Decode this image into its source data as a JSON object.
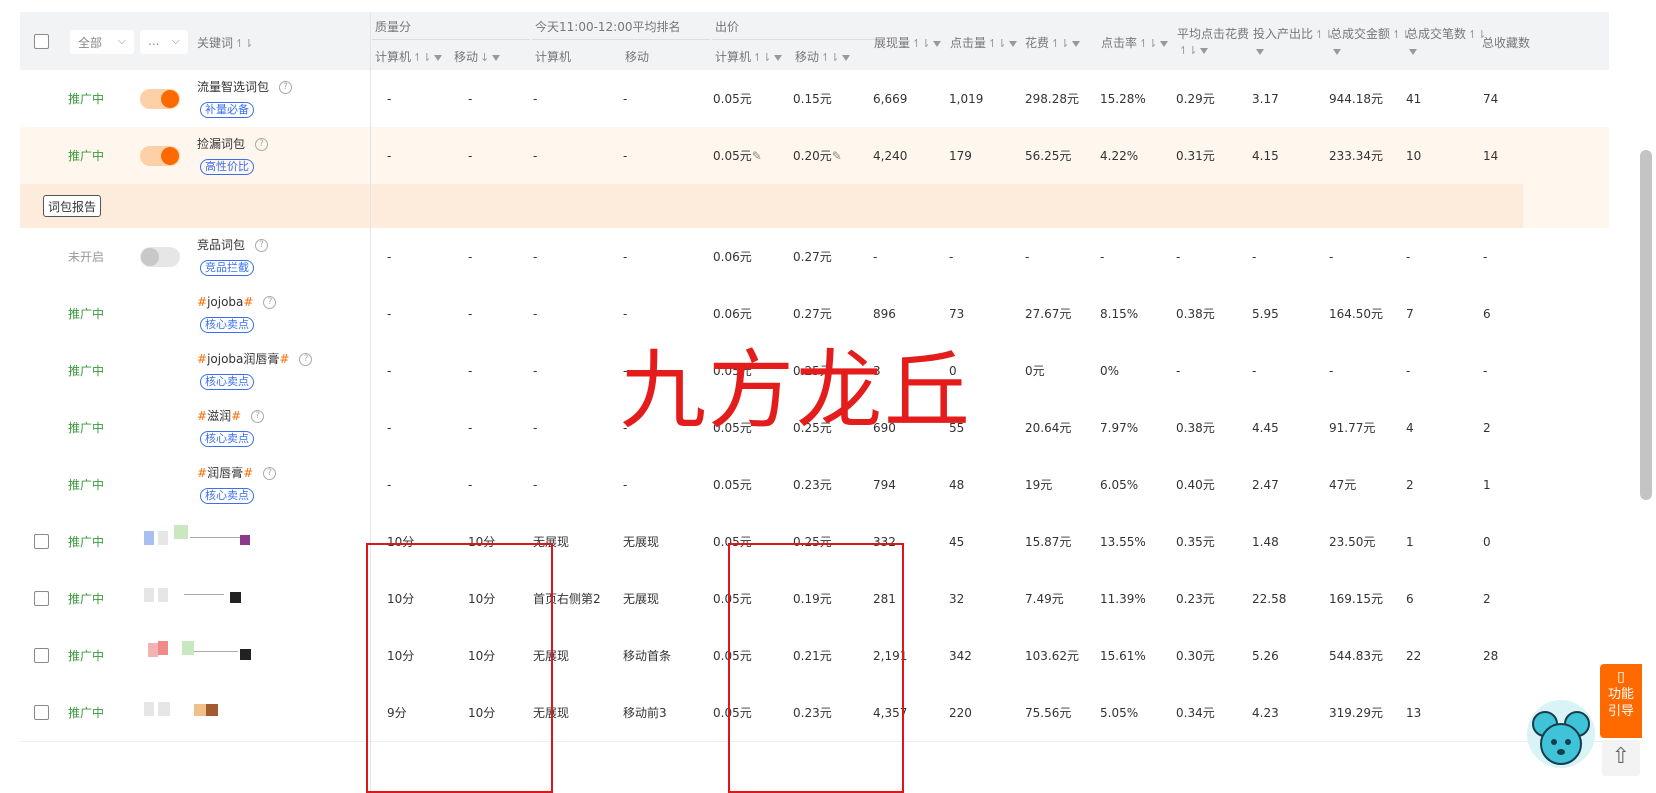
{
  "header": {
    "select_all": "全部",
    "select_more": "...",
    "col_keyword": "关键词",
    "group_quality": "质量分",
    "group_rank": "今天11:00-12:00平均排名",
    "group_bid": "出价",
    "pc": "计算机",
    "mobile": "移动",
    "impressions": "展现量",
    "clicks": "点击量",
    "cost": "花费",
    "ctr": "点击率",
    "avg_cpc": "平均点击花费",
    "roi": "投入产出比",
    "total_gmv": "总成交金额",
    "total_orders": "总成交笔数",
    "total_fav": "总收藏数"
  },
  "rows": [
    {
      "status": "推广中",
      "toggle": "on",
      "keyword": "流量智选词包",
      "hash": false,
      "tag": "补量必备",
      "qpc": "-",
      "qm": "-",
      "rpc": "-",
      "rm": "-",
      "bpc": "0.05元",
      "bm": "0.15元",
      "imp": "6,669",
      "clk": "1,019",
      "cost": "298.28元",
      "ctr": "15.28%",
      "cpc": "0.29元",
      "roi": "3.17",
      "gmv": "944.18元",
      "ord": "41",
      "fav": "74"
    },
    {
      "status": "推广中",
      "toggle": "on",
      "keyword": "捡漏词包",
      "hash": false,
      "tag": "高性价比",
      "qpc": "-",
      "qm": "-",
      "rpc": "-",
      "rm": "-",
      "bpc": "0.05元",
      "bm": "0.20元",
      "imp": "4,240",
      "clk": "179",
      "cost": "56.25元",
      "ctr": "4.22%",
      "cpc": "0.31元",
      "roi": "4.15",
      "gmv": "233.34元",
      "ord": "10",
      "fav": "14"
    },
    {
      "status": "未开启",
      "toggle": "off",
      "keyword": "竞品词包",
      "hash": false,
      "tag": "竞品拦截",
      "qpc": "-",
      "qm": "-",
      "rpc": "-",
      "rm": "-",
      "bpc": "0.06元",
      "bm": "0.27元",
      "imp": "-",
      "clk": "-",
      "cost": "-",
      "ctr": "-",
      "cpc": "-",
      "roi": "-",
      "gmv": "-",
      "ord": "-",
      "fav": "-"
    },
    {
      "status": "推广中",
      "toggle": "none",
      "keyword": "jojoba",
      "hash": true,
      "tag": "核心卖点",
      "qpc": "-",
      "qm": "-",
      "rpc": "-",
      "rm": "-",
      "bpc": "0.06元",
      "bm": "0.27元",
      "imp": "896",
      "clk": "73",
      "cost": "27.67元",
      "ctr": "8.15%",
      "cpc": "0.38元",
      "roi": "5.95",
      "gmv": "164.50元",
      "ord": "7",
      "fav": "6"
    },
    {
      "status": "推广中",
      "toggle": "none",
      "keyword": "jojoba润唇膏",
      "hash": true,
      "tag": "核心卖点",
      "qpc": "-",
      "qm": "-",
      "rpc": "-",
      "rm": "-",
      "bpc": "0.05元",
      "bm": "0.25元",
      "imp": "3",
      "clk": "0",
      "cost": "0元",
      "ctr": "0%",
      "cpc": "-",
      "roi": "-",
      "gmv": "-",
      "ord": "-",
      "fav": "-"
    },
    {
      "status": "推广中",
      "toggle": "none",
      "keyword": "滋润",
      "hash": true,
      "tag": "核心卖点",
      "qpc": "-",
      "qm": "-",
      "rpc": "-",
      "rm": "-",
      "bpc": "0.05元",
      "bm": "0.25元",
      "imp": "690",
      "clk": "55",
      "cost": "20.64元",
      "ctr": "7.97%",
      "cpc": "0.38元",
      "roi": "4.45",
      "gmv": "91.77元",
      "ord": "4",
      "fav": "2"
    },
    {
      "status": "推广中",
      "toggle": "none",
      "keyword": "润唇膏",
      "hash": true,
      "tag": "核心卖点",
      "qpc": "-",
      "qm": "-",
      "rpc": "-",
      "rm": "-",
      "bpc": "0.05元",
      "bm": "0.23元",
      "imp": "794",
      "clk": "48",
      "cost": "19元",
      "ctr": "6.05%",
      "cpc": "0.40元",
      "roi": "2.47",
      "gmv": "47元",
      "ord": "2",
      "fav": "1"
    },
    {
      "status": "推广中",
      "toggle": "none",
      "keyword": "",
      "hash": false,
      "tag": "",
      "qpc": "10分",
      "qm": "10分",
      "rpc": "无展现",
      "rm": "无展现",
      "bpc": "0.05元",
      "bm": "0.25元",
      "imp": "332",
      "clk": "45",
      "cost": "15.87元",
      "ctr": "13.55%",
      "cpc": "0.35元",
      "roi": "1.48",
      "gmv": "23.50元",
      "ord": "1",
      "fav": "0"
    },
    {
      "status": "推广中",
      "toggle": "none",
      "keyword": "",
      "hash": false,
      "tag": "",
      "qpc": "10分",
      "qm": "10分",
      "rpc": "首页右侧第2",
      "rm": "无展现",
      "bpc": "0.05元",
      "bm": "0.19元",
      "imp": "281",
      "clk": "32",
      "cost": "7.49元",
      "ctr": "11.39%",
      "cpc": "0.23元",
      "roi": "22.58",
      "gmv": "169.15元",
      "ord": "6",
      "fav": "2"
    },
    {
      "status": "推广中",
      "toggle": "none",
      "keyword": "",
      "hash": false,
      "tag": "",
      "qpc": "10分",
      "qm": "10分",
      "rpc": "无展现",
      "rm": "移动首条",
      "bpc": "0.05元",
      "bm": "0.21元",
      "imp": "2,191",
      "clk": "342",
      "cost": "103.62元",
      "ctr": "15.61%",
      "cpc": "0.30元",
      "roi": "5.26",
      "gmv": "544.83元",
      "ord": "22",
      "fav": "28"
    },
    {
      "status": "推广中",
      "toggle": "none",
      "keyword": "",
      "hash": false,
      "tag": "",
      "qpc": "9分",
      "qm": "10分",
      "rpc": "无展现",
      "rm": "移动前3",
      "bpc": "0.05元",
      "bm": "0.23元",
      "imp": "4,357",
      "clk": "220",
      "cost": "75.56元",
      "ctr": "5.05%",
      "cpc": "0.34元",
      "roi": "4.23",
      "gmv": "319.29元",
      "ord": "13",
      "fav": ""
    }
  ],
  "report_button": "词包报告",
  "watermark": "九方龙丘",
  "guide": {
    "line1": "功能",
    "line2": "引导"
  },
  "colors": {
    "accent": "#ff6a00",
    "status_green": "#3a9a3a",
    "tag_blue": "#3a6ff0",
    "highlight": "#e0141d"
  }
}
